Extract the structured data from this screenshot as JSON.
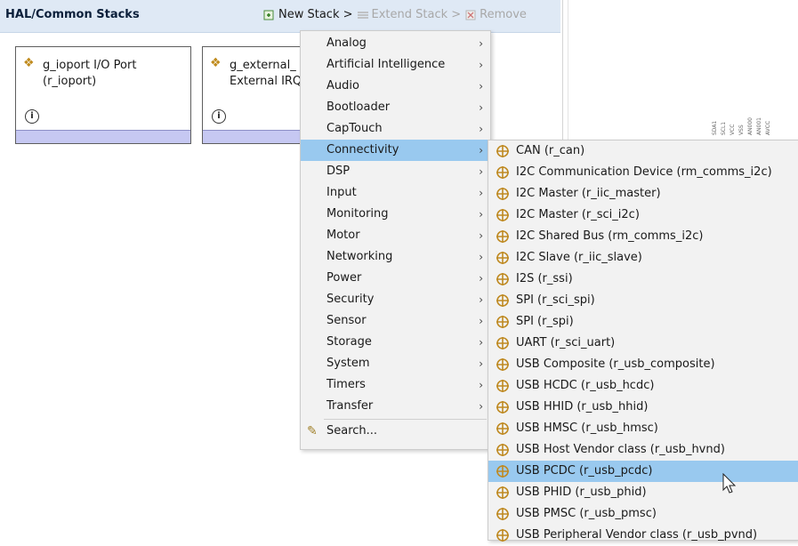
{
  "header": {
    "title": "HAL/Common Stacks",
    "toolbar": [
      {
        "label": "New Stack >",
        "icon": "new-stack-icon",
        "enabled": true
      },
      {
        "label": "Extend Stack >",
        "icon": "extend-stack-icon",
        "enabled": false
      },
      {
        "label": "Remove",
        "icon": "remove-icon",
        "enabled": false
      }
    ]
  },
  "cards": [
    {
      "line1": "g_ioport I/O Port",
      "line2": "(r_ioport)"
    },
    {
      "line1": "g_external_",
      "line2": "External IRQ"
    }
  ],
  "right_panel_labels": [
    "SDA1",
    "SCL1",
    "VCC",
    "VSS",
    "AN000",
    "AN001",
    "AVCC"
  ],
  "menu": {
    "items": [
      {
        "label": "Analog",
        "submenu": true
      },
      {
        "label": "Artificial Intelligence",
        "submenu": true
      },
      {
        "label": "Audio",
        "submenu": true
      },
      {
        "label": "Bootloader",
        "submenu": true
      },
      {
        "label": "CapTouch",
        "submenu": true
      },
      {
        "label": "Connectivity",
        "submenu": true,
        "highlighted": true
      },
      {
        "label": "DSP",
        "submenu": true
      },
      {
        "label": "Input",
        "submenu": true
      },
      {
        "label": "Monitoring",
        "submenu": true
      },
      {
        "label": "Motor",
        "submenu": true
      },
      {
        "label": "Networking",
        "submenu": true
      },
      {
        "label": "Power",
        "submenu": true
      },
      {
        "label": "Security",
        "submenu": true
      },
      {
        "label": "Sensor",
        "submenu": true
      },
      {
        "label": "Storage",
        "submenu": true
      },
      {
        "label": "System",
        "submenu": true
      },
      {
        "label": "Timers",
        "submenu": true
      },
      {
        "label": "Transfer",
        "submenu": true
      }
    ],
    "search_label": "Search..."
  },
  "submenu": {
    "items": [
      {
        "label": "CAN (r_can)"
      },
      {
        "label": "I2C Communication Device (rm_comms_i2c)"
      },
      {
        "label": "I2C Master (r_iic_master)"
      },
      {
        "label": "I2C Master (r_sci_i2c)"
      },
      {
        "label": "I2C Shared Bus (rm_comms_i2c)"
      },
      {
        "label": "I2C Slave (r_iic_slave)"
      },
      {
        "label": "I2S (r_ssi)"
      },
      {
        "label": "SPI (r_sci_spi)"
      },
      {
        "label": "SPI (r_spi)"
      },
      {
        "label": "UART (r_sci_uart)"
      },
      {
        "label": "USB Composite (r_usb_composite)"
      },
      {
        "label": "USB HCDC (r_usb_hcdc)"
      },
      {
        "label": "USB HHID (r_usb_hhid)"
      },
      {
        "label": "USB HMSC (r_usb_hmsc)"
      },
      {
        "label": "USB Host Vendor class (r_usb_hvnd)"
      },
      {
        "label": "USB PCDC (r_usb_pcdc)",
        "highlighted": true
      },
      {
        "label": "USB PHID (r_usb_phid)"
      },
      {
        "label": "USB PMSC (r_usb_pmsc)"
      },
      {
        "label": "USB Peripheral Vendor class (r_usb_pvnd)"
      }
    ]
  },
  "colors": {
    "highlight": "#99c9ef",
    "header_bg": "#dfe9f5",
    "card_bar": "#c6c8f2",
    "module_icon": "#bf8a22"
  }
}
